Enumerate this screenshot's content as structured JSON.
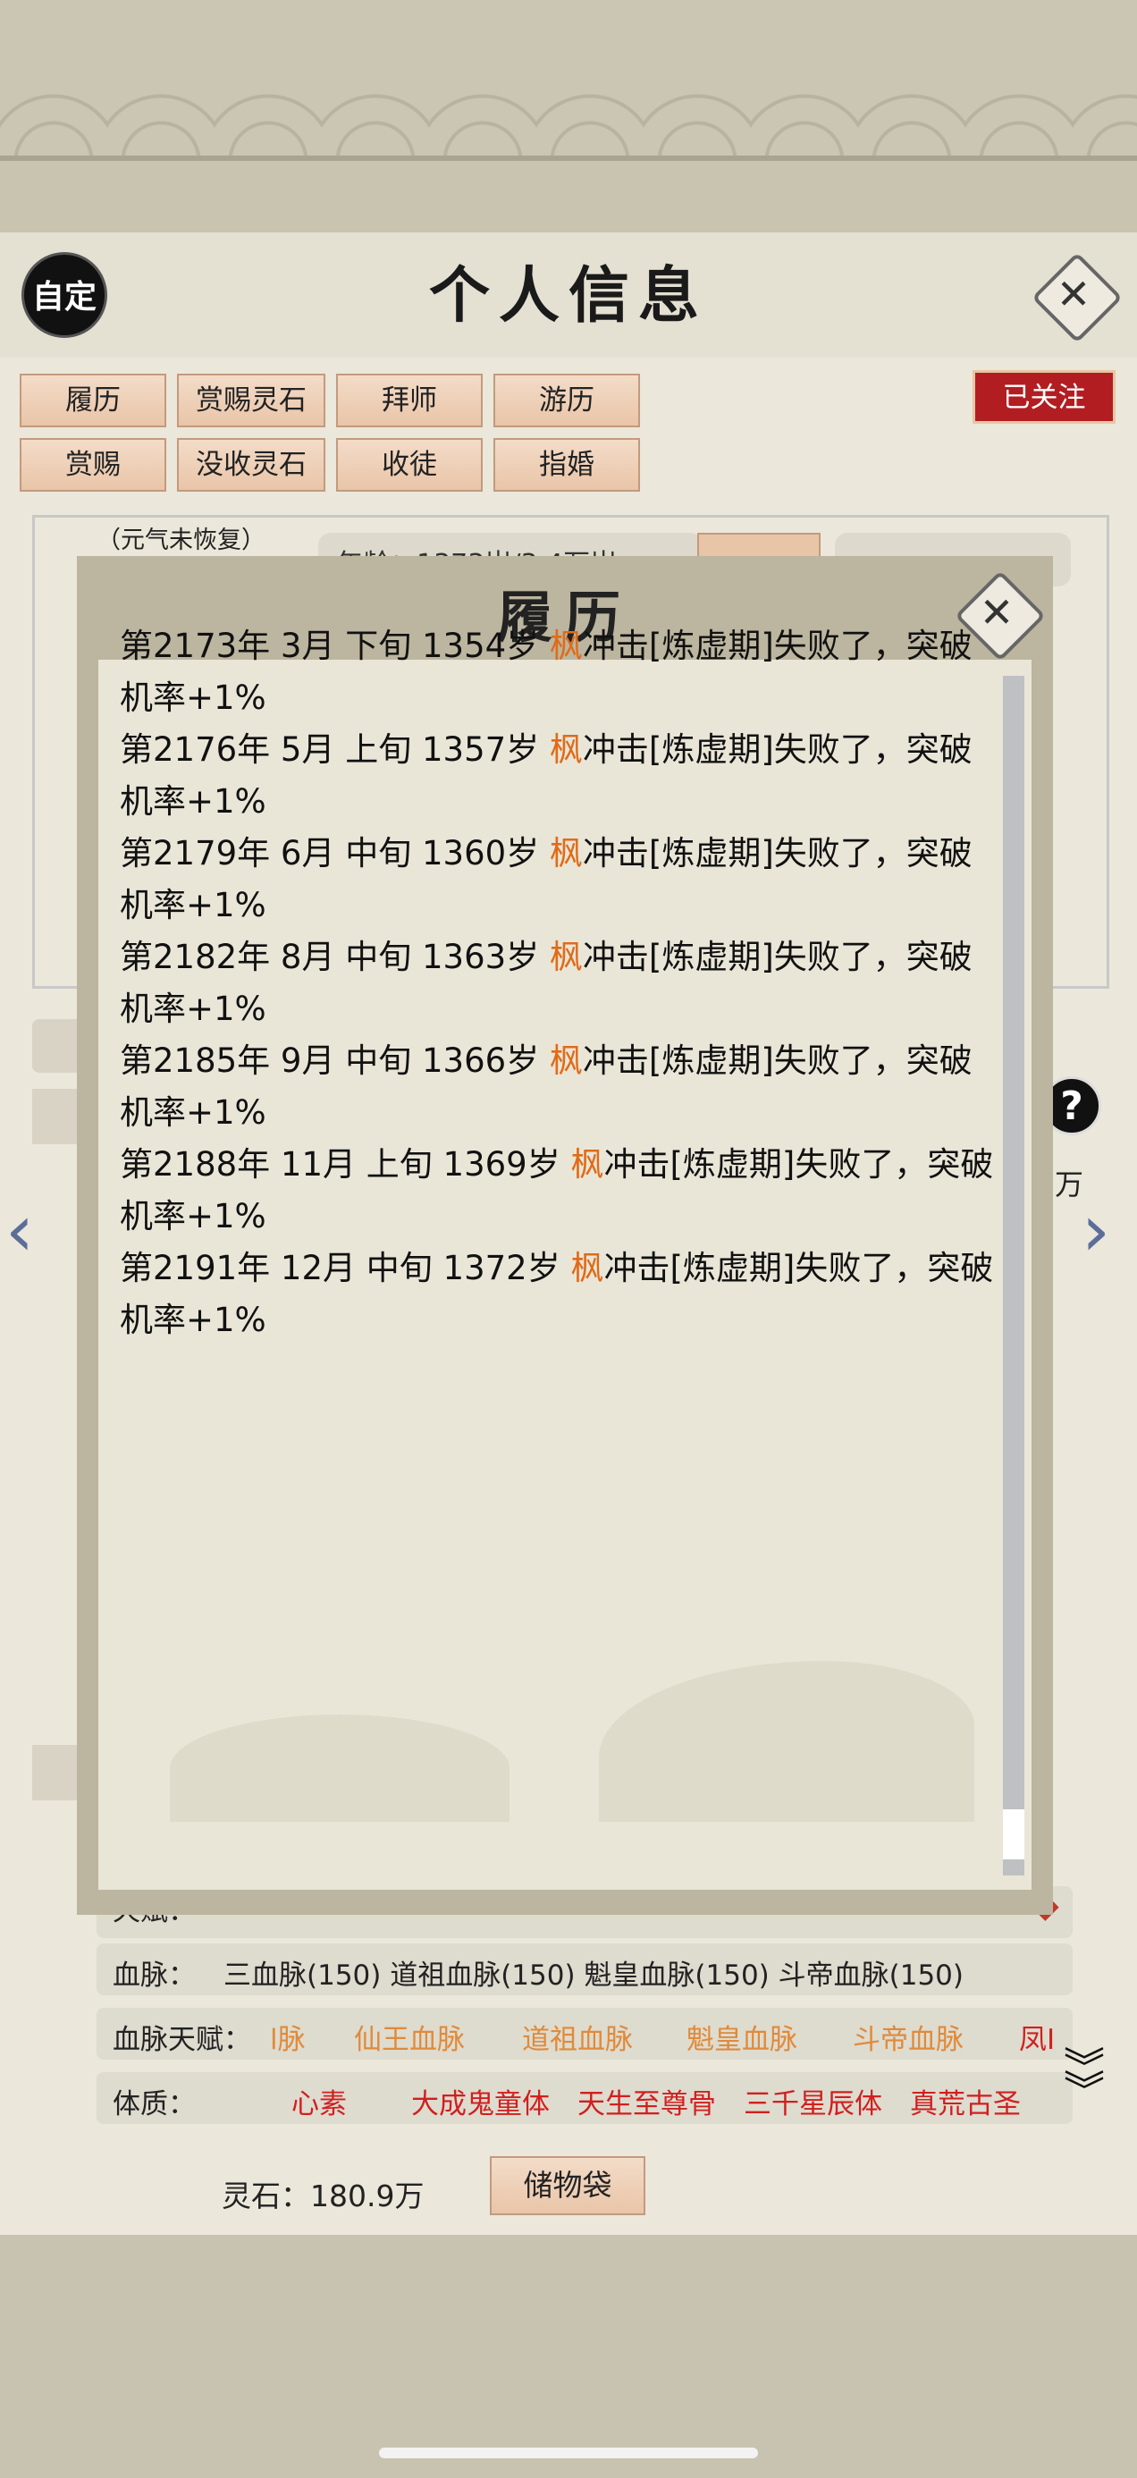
{
  "header": {
    "custom_label": "自定",
    "title": "个人信息",
    "close_glyph": "✕"
  },
  "tabs": {
    "row1": [
      "履历",
      "赏赐灵石",
      "拜师",
      "游历"
    ],
    "row2": [
      "赏赐",
      "没收灵石",
      "收徒",
      "指婚"
    ],
    "followed_label": "已关注"
  },
  "profile": {
    "vital_note": "（元气未恢复）",
    "age_partial": "年龄：1373岁/3.4万岁"
  },
  "side_help": {
    "help_glyph": "?",
    "wan_label": "万"
  },
  "rows": {
    "talent_label": "天赋：",
    "bloodline_label": "血脉：",
    "bloodline_values": "三血脉(150)    道祖血脉(150)    魁皇血脉(150)    斗帝血脉(150)",
    "bloodline_talent_label": "血脉天赋：",
    "bloodline_talent_values": [
      "l脉",
      "仙王血脉",
      "道祖血脉",
      "魁皇血脉",
      "斗帝血脉",
      "凤I"
    ],
    "physique_label": "体质：",
    "physique_values": [
      "心素",
      "大成鬼童体",
      "天生至尊骨",
      "三千星辰体",
      "真荒古圣"
    ]
  },
  "footer": {
    "spirit_stone": "灵石：180.9万",
    "storage_label": "储物袋"
  },
  "modal": {
    "title": "履历",
    "close_glyph": "✕",
    "log": [
      {
        "prefix": "第2173年 3月 下旬 1354岁 ",
        "name": "枫",
        "suffix": "冲击[炼虚期]失败了，突破机率+1%"
      },
      {
        "prefix": "第2176年 5月 上旬 1357岁 ",
        "name": "枫",
        "suffix": "冲击[炼虚期]失败了，突破机率+1%"
      },
      {
        "prefix": "第2179年 6月 中旬 1360岁 ",
        "name": "枫",
        "suffix": "冲击[炼虚期]失败了，突破机率+1%"
      },
      {
        "prefix": "第2182年 8月 中旬 1363岁 ",
        "name": "枫",
        "suffix": "冲击[炼虚期]失败了，突破机率+1%"
      },
      {
        "prefix": "第2185年 9月 中旬 1366岁 ",
        "name": "枫",
        "suffix": "冲击[炼虚期]失败了，突破机率+1%"
      },
      {
        "prefix": "第2188年 11月 上旬 1369岁 ",
        "name": "枫",
        "suffix": "冲击[炼虚期]失败了，突破机率+1%"
      },
      {
        "prefix": "第2191年 12月 中旬 1372岁 ",
        "name": "枫",
        "suffix": "冲击[炼虚期]失败了，突破机率+1%"
      }
    ]
  },
  "colors": {
    "accent_orange": "#e06b18",
    "badge_red": "#b21d22",
    "value_red": "#d11f1f",
    "value_orange": "#e08a3a"
  },
  "icons": {
    "left_arrow": "chevron-left-icon",
    "right_arrow": "chevron-right-icon",
    "expand": "double-chevron-down-icon"
  }
}
